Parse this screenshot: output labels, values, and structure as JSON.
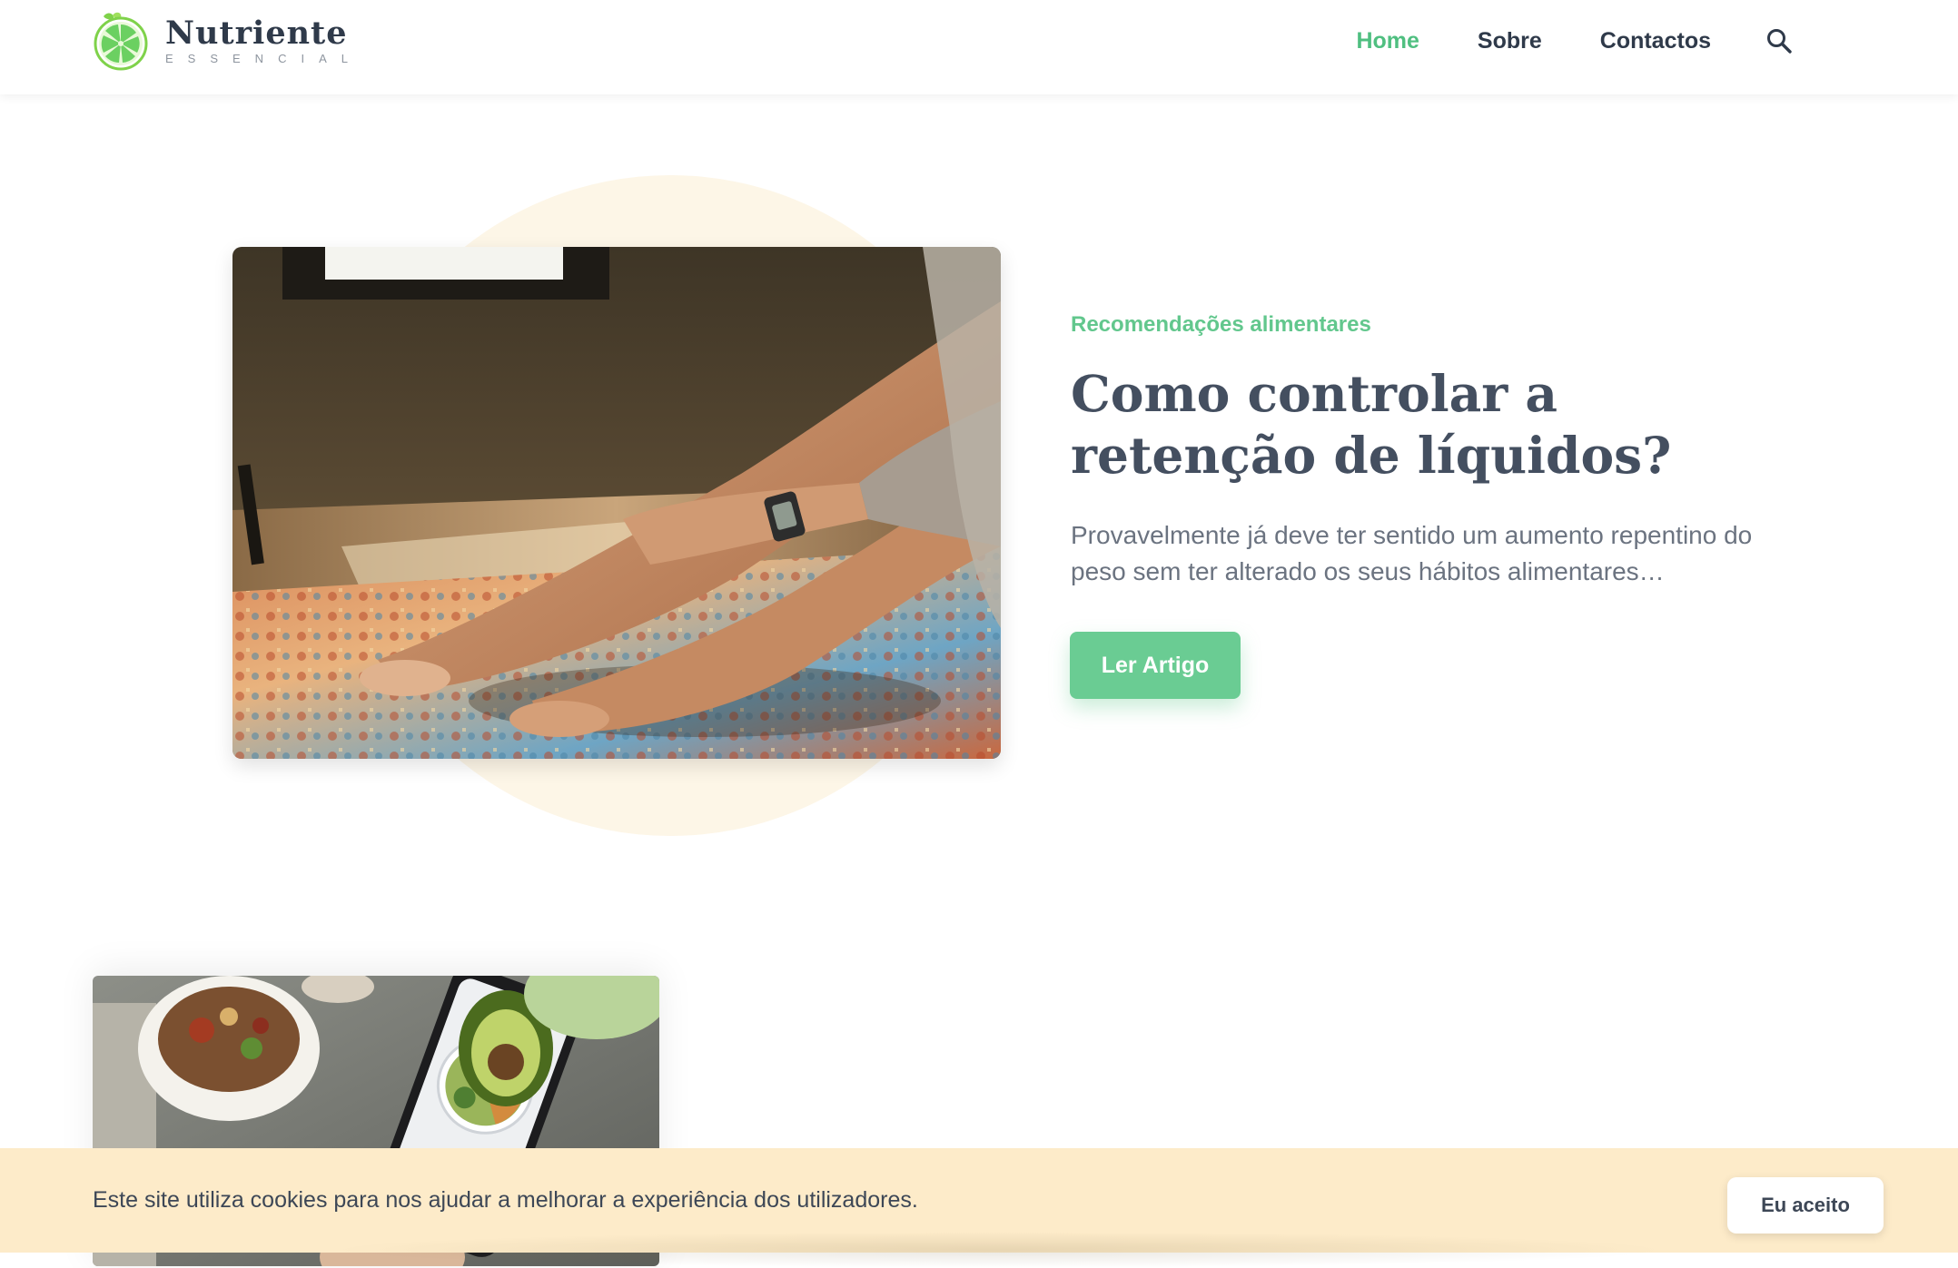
{
  "brand": {
    "name": "Nutriente",
    "tagline": "ESSENCIAL",
    "green": "#4fbf80",
    "cream": "#fdf6e7"
  },
  "nav": {
    "items": [
      {
        "label": "Home",
        "active": true
      },
      {
        "label": "Sobre",
        "active": false
      },
      {
        "label": "Contactos",
        "active": false
      }
    ],
    "search_icon": "search-icon"
  },
  "featured": {
    "category": "Recomendações alimentares",
    "title": "Como controlar a retenção de líquidos?",
    "excerpt": "Provavelmente já deve ter sentido um aumento repentino do peso sem ter alterado os seus hábitos alimentares…",
    "button_label": "Ler Artigo"
  },
  "cookie": {
    "message": "Este site utiliza cookies para nos ajudar a melhorar a experiência dos utilizadores.",
    "accept_label": "Eu aceito",
    "background": "#fdebc9"
  }
}
